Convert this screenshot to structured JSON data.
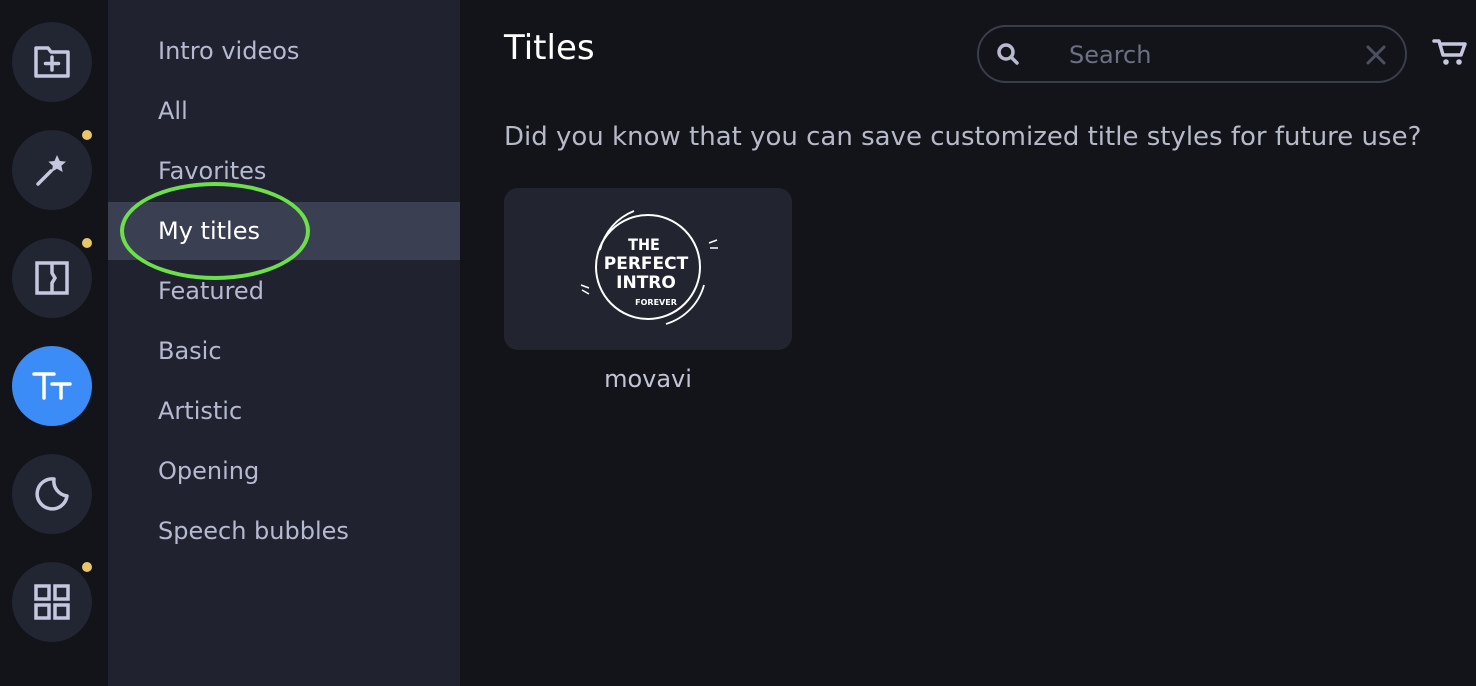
{
  "rail": {
    "items": [
      {
        "name": "import-media",
        "icon": "folder-plus-icon",
        "badge": false,
        "active": false
      },
      {
        "name": "effects",
        "icon": "magic-wand-icon",
        "badge": true,
        "active": false
      },
      {
        "name": "transitions",
        "icon": "transition-icon",
        "badge": true,
        "active": false
      },
      {
        "name": "titles",
        "icon": "text-tt-icon",
        "badge": false,
        "active": true
      },
      {
        "name": "stickers",
        "icon": "sticker-icon",
        "badge": false,
        "active": false
      },
      {
        "name": "more",
        "icon": "grid-icon",
        "badge": true,
        "active": false
      }
    ]
  },
  "categories": {
    "items": [
      {
        "label": "Intro videos"
      },
      {
        "label": "All"
      },
      {
        "label": "Favorites"
      },
      {
        "label": "My titles",
        "active": true
      },
      {
        "label": "Featured"
      },
      {
        "label": "Basic"
      },
      {
        "label": "Artistic"
      },
      {
        "label": "Opening"
      },
      {
        "label": "Speech bubbles"
      }
    ]
  },
  "main": {
    "title": "Titles",
    "hint": "Did you know that you can save customized title styles for future use?",
    "search": {
      "placeholder": "Search",
      "value": ""
    },
    "cards": [
      {
        "label": "movavi",
        "thumb_lines": [
          "THE",
          "PERFECT",
          "INTRO",
          "FOREVER"
        ]
      }
    ]
  },
  "colors": {
    "accent": "#3b8cf6",
    "badge": "#e8c766",
    "highlight_ring": "#6ce04a"
  }
}
